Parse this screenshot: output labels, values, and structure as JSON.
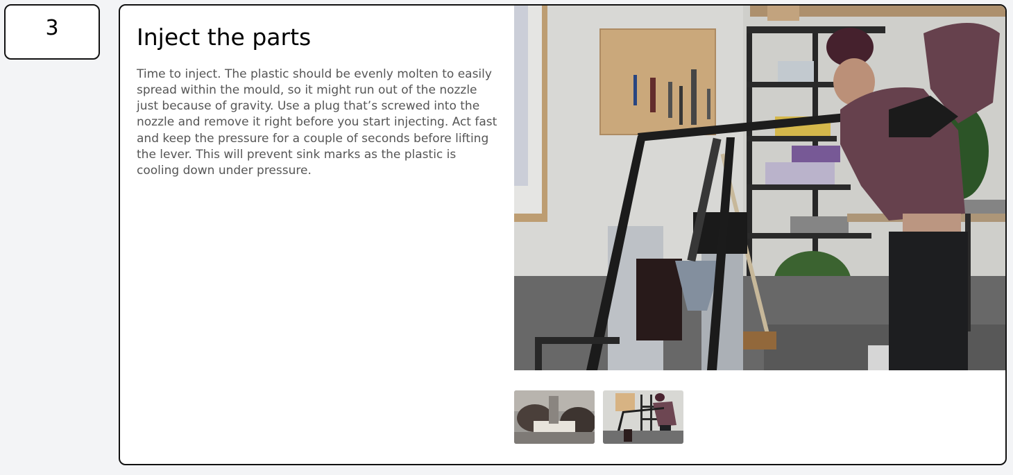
{
  "step": {
    "number": "3",
    "title": "Inject the parts",
    "description": "Time to inject. The plastic should be evenly molten to easily spread within the mould, so it might run out of the nozzle just because of gravity. Use a plug that’s screwed into the nozzle and remove it right before you start injecting. Act fast and keep the pressure for a couple of seconds before lifting the lever. This will prevent sink marks as the plastic is cooling down under pressure."
  },
  "gallery": {
    "main_photo": "workshop-lever-injection-photo",
    "thumbnails": [
      {
        "id": "thumbnail-mould-plug"
      },
      {
        "id": "thumbnail-workshop-lever"
      }
    ]
  }
}
